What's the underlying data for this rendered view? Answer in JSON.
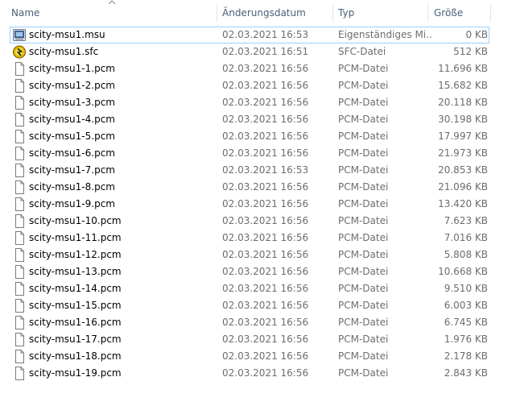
{
  "columns": {
    "name": "Name",
    "date": "Änderungsdatum",
    "type": "Typ",
    "size": "Größe",
    "sort_column": "name",
    "sort_icon": "sort-up-icon"
  },
  "files": [
    {
      "name": "scity-msu1.msu",
      "date": "02.03.2021 16:53",
      "type": "Eigenständiges Mi...",
      "size": "0 KB",
      "icon": "msu-file-icon",
      "selected": true
    },
    {
      "name": "scity-msu1.sfc",
      "date": "02.03.2021 16:51",
      "type": "SFC-Datei",
      "size": "512 KB",
      "icon": "sfc-file-icon",
      "selected": false
    },
    {
      "name": "scity-msu1-1.pcm",
      "date": "02.03.2021 16:56",
      "type": "PCM-Datei",
      "size": "11.696 KB",
      "icon": "document-icon",
      "selected": false
    },
    {
      "name": "scity-msu1-2.pcm",
      "date": "02.03.2021 16:56",
      "type": "PCM-Datei",
      "size": "15.682 KB",
      "icon": "document-icon",
      "selected": false
    },
    {
      "name": "scity-msu1-3.pcm",
      "date": "02.03.2021 16:56",
      "type": "PCM-Datei",
      "size": "20.118 KB",
      "icon": "document-icon",
      "selected": false
    },
    {
      "name": "scity-msu1-4.pcm",
      "date": "02.03.2021 16:56",
      "type": "PCM-Datei",
      "size": "30.198 KB",
      "icon": "document-icon",
      "selected": false
    },
    {
      "name": "scity-msu1-5.pcm",
      "date": "02.03.2021 16:56",
      "type": "PCM-Datei",
      "size": "17.997 KB",
      "icon": "document-icon",
      "selected": false
    },
    {
      "name": "scity-msu1-6.pcm",
      "date": "02.03.2021 16:56",
      "type": "PCM-Datei",
      "size": "21.973 KB",
      "icon": "document-icon",
      "selected": false
    },
    {
      "name": "scity-msu1-7.pcm",
      "date": "02.03.2021 16:53",
      "type": "PCM-Datei",
      "size": "20.853 KB",
      "icon": "document-icon",
      "selected": false
    },
    {
      "name": "scity-msu1-8.pcm",
      "date": "02.03.2021 16:56",
      "type": "PCM-Datei",
      "size": "21.096 KB",
      "icon": "document-icon",
      "selected": false
    },
    {
      "name": "scity-msu1-9.pcm",
      "date": "02.03.2021 16:56",
      "type": "PCM-Datei",
      "size": "13.420 KB",
      "icon": "document-icon",
      "selected": false
    },
    {
      "name": "scity-msu1-10.pcm",
      "date": "02.03.2021 16:56",
      "type": "PCM-Datei",
      "size": "7.623 KB",
      "icon": "document-icon",
      "selected": false
    },
    {
      "name": "scity-msu1-11.pcm",
      "date": "02.03.2021 16:56",
      "type": "PCM-Datei",
      "size": "7.016 KB",
      "icon": "document-icon",
      "selected": false
    },
    {
      "name": "scity-msu1-12.pcm",
      "date": "02.03.2021 16:56",
      "type": "PCM-Datei",
      "size": "5.808 KB",
      "icon": "document-icon",
      "selected": false
    },
    {
      "name": "scity-msu1-13.pcm",
      "date": "02.03.2021 16:56",
      "type": "PCM-Datei",
      "size": "10.668 KB",
      "icon": "document-icon",
      "selected": false
    },
    {
      "name": "scity-msu1-14.pcm",
      "date": "02.03.2021 16:56",
      "type": "PCM-Datei",
      "size": "9.510 KB",
      "icon": "document-icon",
      "selected": false
    },
    {
      "name": "scity-msu1-15.pcm",
      "date": "02.03.2021 16:56",
      "type": "PCM-Datei",
      "size": "6.003 KB",
      "icon": "document-icon",
      "selected": false
    },
    {
      "name": "scity-msu1-16.pcm",
      "date": "02.03.2021 16:56",
      "type": "PCM-Datei",
      "size": "6.745 KB",
      "icon": "document-icon",
      "selected": false
    },
    {
      "name": "scity-msu1-17.pcm",
      "date": "02.03.2021 16:56",
      "type": "PCM-Datei",
      "size": "1.976 KB",
      "icon": "document-icon",
      "selected": false
    },
    {
      "name": "scity-msu1-18.pcm",
      "date": "02.03.2021 16:56",
      "type": "PCM-Datei",
      "size": "2.178 KB",
      "icon": "document-icon",
      "selected": false
    },
    {
      "name": "scity-msu1-19.pcm",
      "date": "02.03.2021 16:56",
      "type": "PCM-Datei",
      "size": "2.843 KB",
      "icon": "document-icon",
      "selected": false
    }
  ],
  "colors": {
    "header_text": "#4c607a",
    "secondary_text": "#6d6d6d",
    "selection_border": "#99d1ff"
  }
}
